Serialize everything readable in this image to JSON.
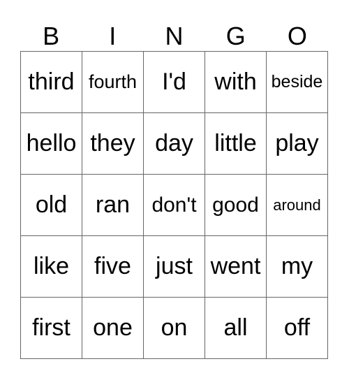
{
  "header": {
    "letters": [
      "B",
      "I",
      "N",
      "G",
      "O"
    ]
  },
  "card": {
    "rows": [
      [
        "third",
        "fourth",
        "I'd",
        "with",
        "beside"
      ],
      [
        "hello",
        "they",
        "day",
        "little",
        "play"
      ],
      [
        "old",
        "ran",
        "don't",
        "good",
        "around"
      ],
      [
        "like",
        "five",
        "just",
        "went",
        "my"
      ],
      [
        "first",
        "one",
        "on",
        "all",
        "off"
      ]
    ]
  }
}
